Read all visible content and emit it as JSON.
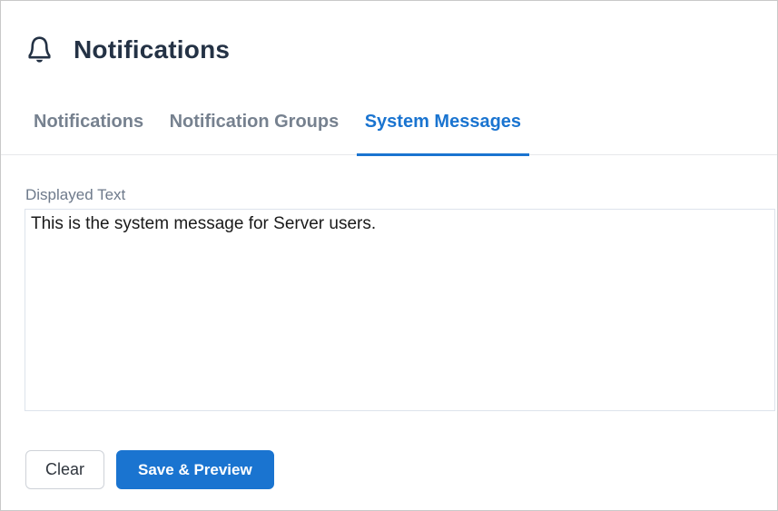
{
  "header": {
    "title": "Notifications",
    "icon": "bell-icon"
  },
  "tabs": [
    {
      "label": "Notifications",
      "active": false
    },
    {
      "label": "Notification Groups",
      "active": false
    },
    {
      "label": "System Messages",
      "active": true
    }
  ],
  "form": {
    "displayed_text_label": "Displayed Text",
    "displayed_text_value": "This is the system message for Server users."
  },
  "buttons": {
    "clear_label": "Clear",
    "save_preview_label": "Save & Preview"
  },
  "colors": {
    "accent_blue": "#1a74d0",
    "title_dark": "#243245",
    "tab_inactive_gray": "#76818f",
    "label_gray": "#6e7a8b",
    "textarea_border": "#dde3ec",
    "page_border": "#c9c9c9"
  }
}
